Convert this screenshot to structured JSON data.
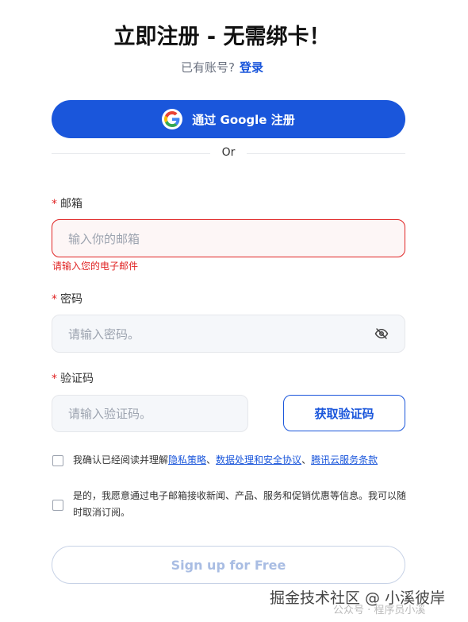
{
  "header": {
    "title": "立即注册 - 无需绑卡！",
    "has_account": "已有账号?",
    "login_link": "登录"
  },
  "google": {
    "label": "通过 Google 注册"
  },
  "divider": {
    "text": "Or"
  },
  "email": {
    "required": "*",
    "label": "邮箱",
    "placeholder": "输入你的邮箱",
    "error": "请输入您的电子邮件"
  },
  "password": {
    "required": "*",
    "label": "密码",
    "placeholder": "请输入密码。"
  },
  "code": {
    "required": "*",
    "label": "验证码",
    "placeholder": "请输入验证码。",
    "button": "获取验证码"
  },
  "consent": {
    "prefix": "我确认已经阅读并理解",
    "privacy": "隐私策略",
    "sep1": "、",
    "data": "数据处理和安全协议",
    "sep2": "、",
    "terms": "腾讯云服务条款",
    "marketing_line1": "是的，我愿意通过电子邮箱接收新闻、产品、服务和促销优惠等信息。我可以随",
    "marketing_line2": "时取消订阅。"
  },
  "signup": {
    "label": "Sign up for Free"
  },
  "watermark": {
    "main": "掘金技术社区 @ 小溪彼岸",
    "sub": "公众号 · 程序员小溪"
  },
  "colors": {
    "primary": "#1a56db",
    "error": "#e02424"
  }
}
